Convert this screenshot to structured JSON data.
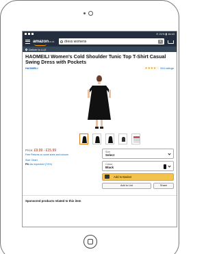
{
  "status_bar": {
    "right": "⊙ 21% ▮ 16:43"
  },
  "header": {
    "logo": "amazon",
    "logo_suffix": ".co.uk",
    "search_value": "dress womens"
  },
  "deliver": {
    "text": "Deliver to LUZ"
  },
  "product": {
    "title": "HAOMEILI Women's Cold Shoulder Tunic Top T-Shirt Casual Swing Dress with Pockets",
    "brand": "HAOMEILI",
    "stars": "★★★★☆",
    "ratings": "534 ratings",
    "price_label": "Price:",
    "price": "£9.99 - £15.99",
    "free_returns": "Free Returns on some sizes and colours",
    "size_chart": "Size Chart",
    "fit_label": "Fit:",
    "fit_value": "As expected (74%)"
  },
  "options": {
    "size_label": "Size",
    "size_value": "Select",
    "colour_label": "Colour",
    "colour_value": "Black"
  },
  "actions": {
    "add_to_basket": "Add to Basket",
    "add_to_list": "Add to List",
    "share": "Share"
  },
  "sponsored": "Sponsored products related to this item",
  "colors": {
    "header": "#232f3e",
    "accent": "#f3c34d",
    "link": "#0066c0",
    "price": "#b12704"
  }
}
